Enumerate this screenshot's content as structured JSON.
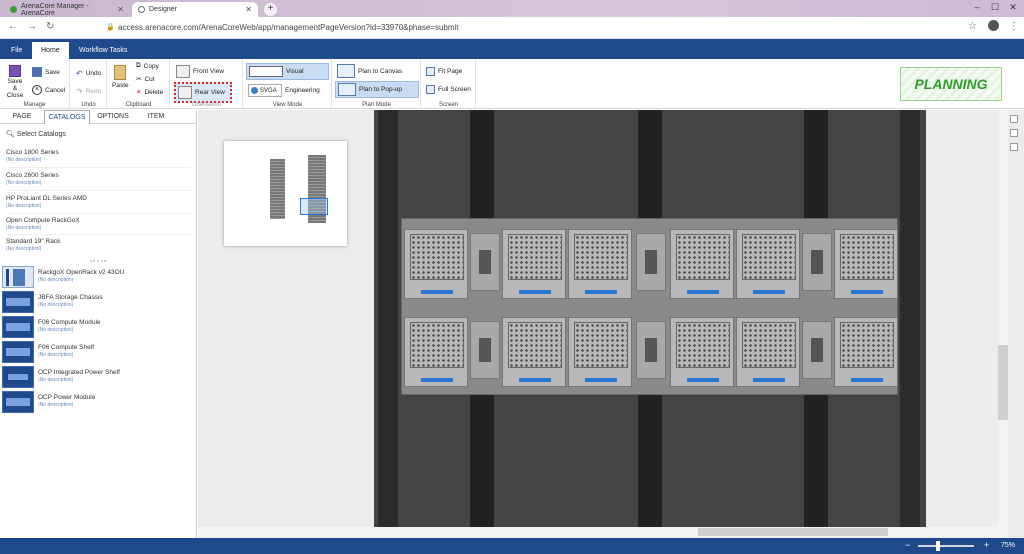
{
  "browser": {
    "tabs": [
      {
        "title": "ArenaCore Manager - ArenaCore"
      },
      {
        "title": "Designer"
      }
    ],
    "url": "access.arenacore.com/ArenaCoreWeb/app/managementPageVersion?id=33970&phase=submit"
  },
  "ribbon_tabs": [
    "File",
    "Home",
    "Workflow Tasks"
  ],
  "ribbon": {
    "manage": {
      "label": "Manage",
      "save_close": "Save & Close",
      "save": "Save",
      "cancel": "Cancel"
    },
    "undo": {
      "label": "Undo",
      "undo": "Undo",
      "redo": "Redo"
    },
    "clipboard": {
      "label": "Clipboard",
      "paste": "Paste",
      "copy": "Copy",
      "cut": "Cut",
      "delete": "Delete"
    },
    "orientation": {
      "label": "Orientation",
      "front": "Front View",
      "rear": "Rear View"
    },
    "view_mode": {
      "label": "View Mode",
      "visual": "Visual",
      "engineering": "Engineering",
      "svga_badge": "SVGA"
    },
    "plan_mode": {
      "label": "Plan Mode",
      "plan_canvas": "Plan to Canvas",
      "plan_popup": "Plan to Pop-up"
    },
    "screen": {
      "label": "Screen",
      "fit_page": "Fit Page",
      "full_screen": "Full Screen"
    }
  },
  "phase_badge": "PLANNING",
  "panel_tabs": [
    "PAGE",
    "CATALOGS",
    "OPTIONS",
    "ITEM"
  ],
  "select_catalogs": "Select Catalogs",
  "catalogs": [
    {
      "name": "Cisco 1800 Series",
      "desc": "(No description)"
    },
    {
      "name": "Cisco 2600 Series",
      "desc": "(No description)"
    },
    {
      "name": "HP ProLiant DL Series AMD",
      "desc": "(No description)"
    },
    {
      "name": "Open Compute RackGoX",
      "desc": "(No description)"
    },
    {
      "name": "Standard 19\" Rack",
      "desc": "(No description)"
    }
  ],
  "components": [
    {
      "name": "RackgoX OpenRack v2 43OU",
      "desc": "(No description)"
    },
    {
      "name": "JBFA Storage Chassis",
      "desc": "(No description)"
    },
    {
      "name": "F06 Compute Module",
      "desc": "(No description)"
    },
    {
      "name": "F06 Compute Shelf",
      "desc": "(No description)"
    },
    {
      "name": "OCP Integrated Power Shelf",
      "desc": "(No description)"
    },
    {
      "name": "OCP Power Module",
      "desc": "(No description)"
    }
  ],
  "status": {
    "zoom_level": "75%",
    "zoom_fraction": 0.36,
    "minus": "−",
    "plus": "+"
  },
  "colors": {
    "brand": "#1e4a8c",
    "planning": "#2f9b2a",
    "accent_blue": "#2a78d6"
  }
}
